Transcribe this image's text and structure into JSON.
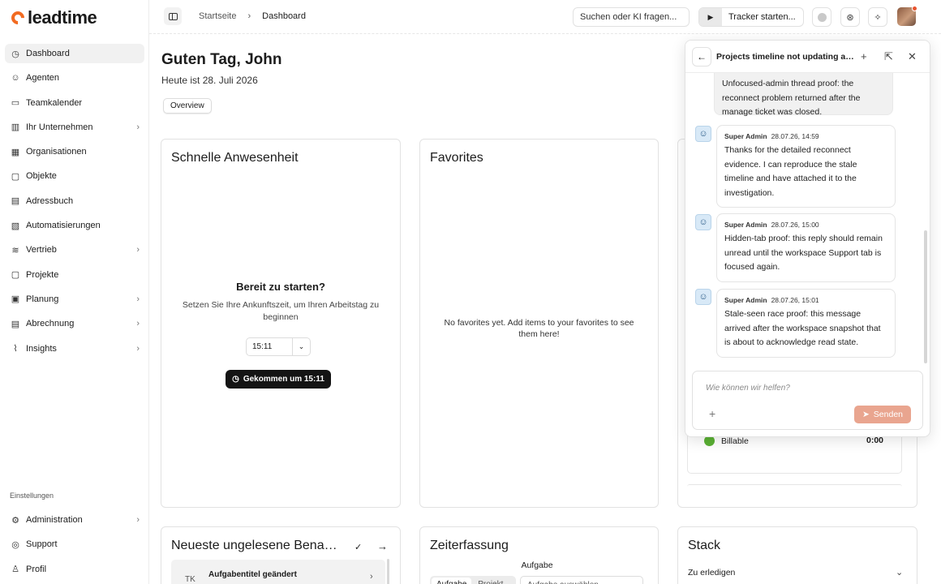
{
  "brand": {
    "name": "leadtime",
    "accent": "#f26b21"
  },
  "sidebar": {
    "items": [
      {
        "label": "Dashboard",
        "icon": "dashboard-icon",
        "active": true
      },
      {
        "label": "Agenten",
        "icon": "agents-icon"
      },
      {
        "label": "Teamkalender",
        "icon": "calendar-icon"
      },
      {
        "label": "Ihr Unternehmen",
        "icon": "company-icon",
        "chevron": true
      },
      {
        "label": "Organisationen",
        "icon": "organisations-icon"
      },
      {
        "label": "Objekte",
        "icon": "objects-icon"
      },
      {
        "label": "Adressbuch",
        "icon": "address-book-icon"
      },
      {
        "label": "Automatisierungen",
        "icon": "automation-icon"
      },
      {
        "label": "Vertrieb",
        "icon": "sales-icon",
        "chevron": true
      },
      {
        "label": "Projekte",
        "icon": "projects-icon"
      },
      {
        "label": "Planung",
        "icon": "planning-icon",
        "chevron": true
      },
      {
        "label": "Abrechnung",
        "icon": "billing-icon",
        "chevron": true
      },
      {
        "label": "Insights",
        "icon": "insights-icon",
        "chevron": true
      }
    ],
    "settings_label": "Einstellungen",
    "bottom_items": [
      {
        "label": "Administration",
        "icon": "settings-icon",
        "chevron": true
      },
      {
        "label": "Support",
        "icon": "support-icon"
      },
      {
        "label": "Profil",
        "icon": "user-icon"
      }
    ]
  },
  "topbar": {
    "breadcrumb": [
      "Startseite",
      "Dashboard"
    ],
    "search_placeholder": "Suchen oder KI fragen...",
    "tracker_label": "Tracker starten..."
  },
  "main": {
    "greeting": "Guten Tag, John",
    "date": "Heute ist 28. Juli 2026",
    "tab": "Overview"
  },
  "attendance": {
    "title": "Schnelle Anwesenheit",
    "ready": "Bereit zu starten?",
    "subtitle": "Setzen Sie Ihre Ankunftszeit, um Ihren Arbeitstag zu beginnen",
    "time": "15:11",
    "button": "Gekommen um 15:11"
  },
  "favorites": {
    "title": "Favorites",
    "empty": "No favorites yet. Add items to your favorites to see them here!"
  },
  "time_summary": {
    "billable_label": "Billable",
    "billable_value": "0:00",
    "billable_color": "#5ab034"
  },
  "notifications": {
    "title": "Neueste ungelesene Benachrichtigungen",
    "item": {
      "initials": "TK",
      "title": "Aufgabentitel geändert"
    }
  },
  "time_tracking": {
    "title": "Zeiterfassung",
    "field_label": "Aufgabe",
    "segments": [
      "Aufgabe",
      "Projekt"
    ],
    "select_placeholder": "Aufgabe auswählen"
  },
  "stack": {
    "title": "Stack",
    "section": "Zu erledigen"
  },
  "chat": {
    "title": "Projects timeline not updating after reconnect",
    "self_message": "Unfocused-admin thread proof: the reconnect problem returned after the manage ticket was closed.",
    "messages": [
      {
        "author": "Super Admin",
        "time": "28.07.26, 14:59",
        "text": "Thanks for the detailed reconnect evidence. I can reproduce the stale timeline and have attached it to the investigation."
      },
      {
        "author": "Super Admin",
        "time": "28.07.26, 15:00",
        "text": "Hidden-tab proof: this reply should remain unread until the workspace Support tab is focused again."
      },
      {
        "author": "Super Admin",
        "time": "28.07.26, 15:01",
        "text": "Stale-seen race proof: this message arrived after the workspace snapshot that is about to acknowledge read state."
      }
    ],
    "input_placeholder": "Wie können wir helfen?",
    "send_label": "Senden",
    "send_color": "#e9a58f"
  }
}
